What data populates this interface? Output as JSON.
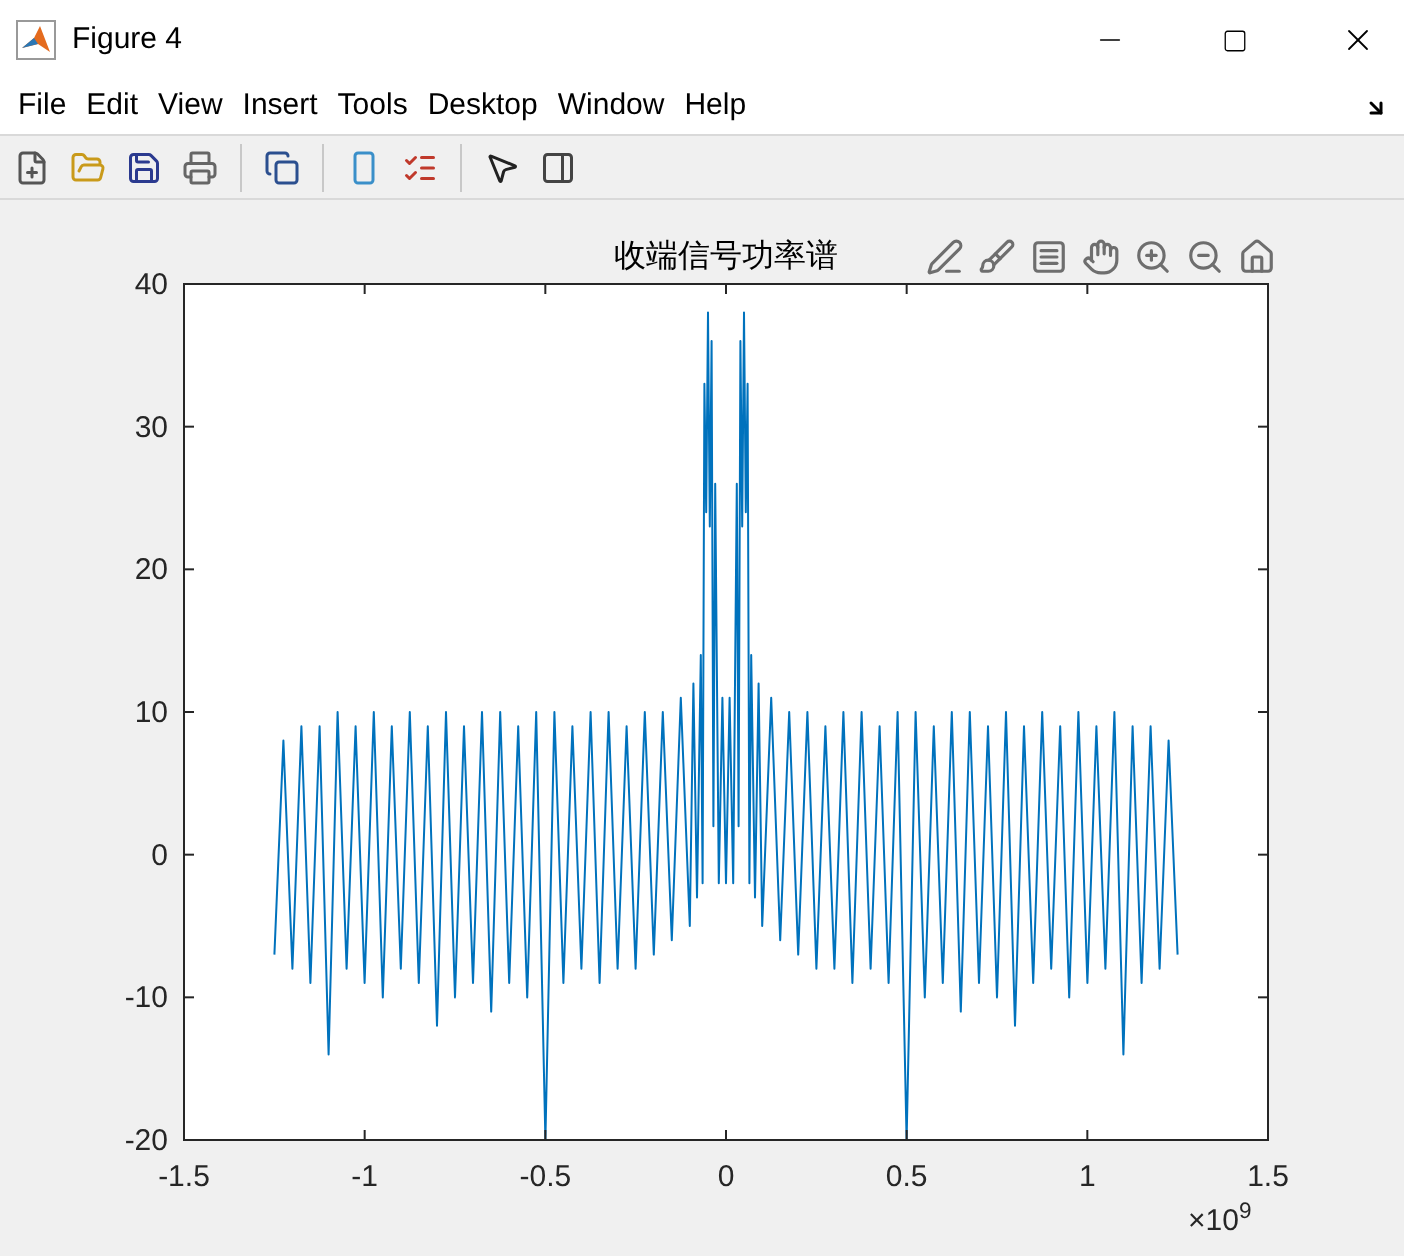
{
  "window": {
    "title": "Figure 4"
  },
  "menu": [
    "File",
    "Edit",
    "View",
    "Insert",
    "Tools",
    "Desktop",
    "Window",
    "Help"
  ],
  "plot": {
    "chart_data": {
      "type": "line",
      "title": "收端信号功率谱",
      "xlim": [
        -1.5,
        1.5
      ],
      "ylim": [
        -20,
        40
      ],
      "grid": false,
      "xticks": [
        {
          "value": -1.5,
          "label": "-1.5"
        },
        {
          "value": -1,
          "label": "-1"
        },
        {
          "value": -0.5,
          "label": "-0.5"
        },
        {
          "value": 0,
          "label": "0"
        },
        {
          "value": 0.5,
          "label": "0.5"
        },
        {
          "value": 1,
          "label": "1"
        },
        {
          "value": 1.5,
          "label": "1.5"
        }
      ],
      "yticks": [
        -20,
        -10,
        0,
        10,
        20,
        30,
        40
      ],
      "x": [
        -1.25,
        -1.225,
        -1.2,
        -1.175,
        -1.15,
        -1.125,
        -1.1,
        -1.075,
        -1.05,
        -1.025,
        -1,
        -0.975,
        -0.95,
        -0.925,
        -0.9,
        -0.875,
        -0.85,
        -0.825,
        -0.8,
        -0.775,
        -0.75,
        -0.725,
        -0.7,
        -0.675,
        -0.65,
        -0.625,
        -0.6,
        -0.575,
        -0.55,
        -0.525,
        -0.5,
        -0.475,
        -0.45,
        -0.425,
        -0.4,
        -0.375,
        -0.35,
        -0.325,
        -0.3,
        -0.275,
        -0.25,
        -0.225,
        -0.2,
        -0.175,
        -0.15,
        -0.125,
        -0.1,
        -0.09,
        -0.08,
        -0.07,
        -0.065,
        -0.06,
        -0.055,
        -0.05,
        -0.045,
        -0.04,
        -0.035,
        -0.03,
        -0.02,
        -0.01,
        0,
        0.01,
        0.02,
        0.03,
        0.035,
        0.04,
        0.045,
        0.05,
        0.055,
        0.06,
        0.065,
        0.07,
        0.08,
        0.09,
        0.1,
        0.125,
        0.15,
        0.175,
        0.2,
        0.225,
        0.25,
        0.275,
        0.3,
        0.325,
        0.35,
        0.375,
        0.4,
        0.425,
        0.45,
        0.475,
        0.5,
        0.525,
        0.55,
        0.575,
        0.6,
        0.625,
        0.65,
        0.675,
        0.7,
        0.725,
        0.75,
        0.775,
        0.8,
        0.825,
        0.85,
        0.875,
        0.9,
        0.925,
        0.95,
        0.975,
        1,
        1.025,
        1.05,
        1.075,
        1.1,
        1.125,
        1.15,
        1.175,
        1.2,
        1.225,
        1.25
      ],
      "series": [
        {
          "color": "#0072bd",
          "values": [
            -7,
            8,
            -8,
            9,
            -9,
            9,
            -14,
            10,
            -8,
            9,
            -9,
            10,
            -10,
            9,
            -8,
            10,
            -9,
            9,
            -12,
            10,
            -10,
            9,
            -9,
            10,
            -11,
            10,
            -9,
            9,
            -10,
            10,
            -20,
            10,
            -9,
            9,
            -8,
            10,
            -9,
            10,
            -8,
            9,
            -8,
            10,
            -7,
            10,
            -6,
            11,
            -5,
            12,
            -3,
            14,
            -2,
            33,
            24,
            38,
            23,
            36,
            2,
            26,
            -2,
            11,
            -2,
            11,
            -2,
            26,
            2,
            36,
            23,
            38,
            24,
            33,
            -2,
            14,
            -3,
            12,
            -5,
            11,
            -6,
            10,
            -7,
            10,
            -8,
            9,
            -8,
            10,
            -9,
            10,
            -8,
            9,
            -9,
            10,
            -20,
            10,
            -10,
            9,
            -9,
            10,
            -11,
            10,
            -9,
            9,
            -10,
            10,
            -12,
            9,
            -9,
            10,
            -8,
            9,
            -10,
            10,
            -9,
            9,
            -8,
            10,
            -14,
            9,
            -9,
            9,
            -8,
            8,
            -7
          ]
        }
      ]
    },
    "exponent": "×10$^{9}$"
  }
}
